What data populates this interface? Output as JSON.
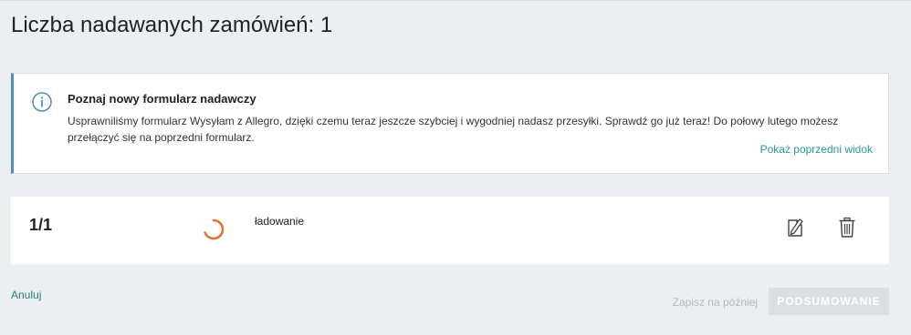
{
  "page": {
    "title": "Liczba nadawanych zamówień: 1"
  },
  "info_box": {
    "icon": "info-icon",
    "title": "Poznaj nowy formularz nadawczy",
    "text": "Usprawniliśmy formularz Wysyłam z Allegro, dzięki czemu teraz jeszcze szybciej i wygodniej nadasz przesyłki. Sprawdź go już teraz! Do połowy lutego możesz przełączyć się na poprzedni formularz.",
    "link_label": "Pokaż poprzedni widok",
    "accent_color": "#4a90c2"
  },
  "order": {
    "count_label": "1/1",
    "status_text": "ładowanie",
    "spinner_color": "#e8702a",
    "edit_icon": "edit-document-icon",
    "delete_icon": "trash-icon"
  },
  "footer": {
    "cancel_label": "Anuluj",
    "save_later_label": "Zapisz na później",
    "summary_label": "PODSUMOWANIE"
  }
}
